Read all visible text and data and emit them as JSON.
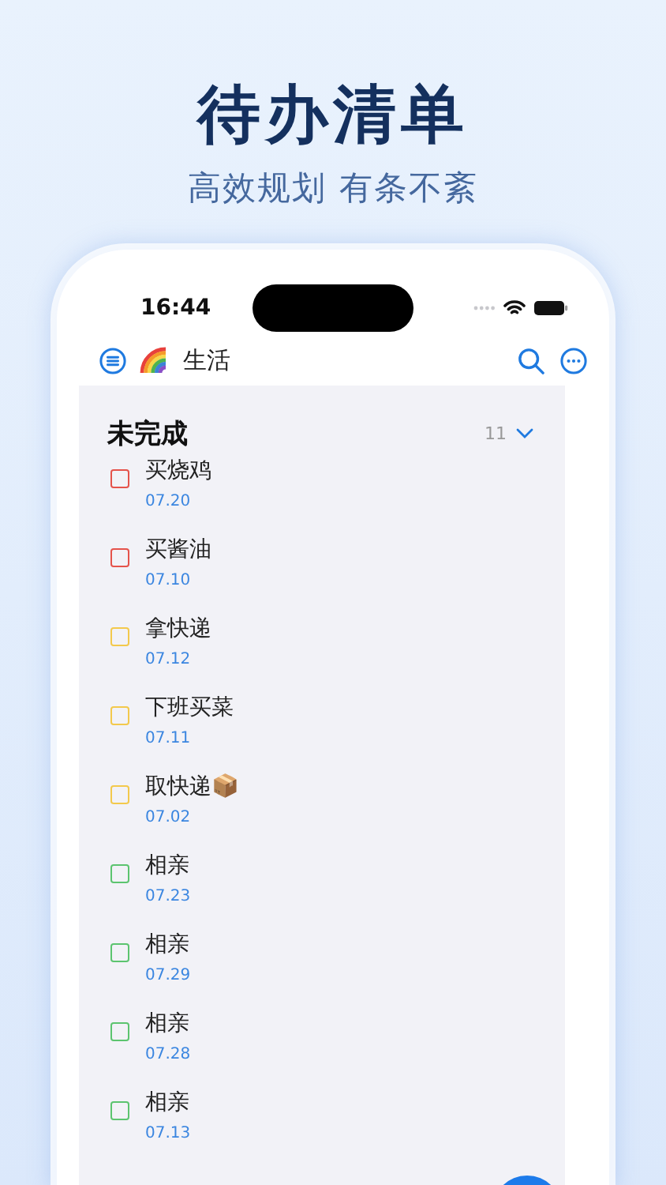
{
  "headline": {
    "title": "待办清单",
    "subtitle": "高效规划 有条不紊"
  },
  "status_bar": {
    "time": "16:44"
  },
  "header": {
    "list_name": "生活"
  },
  "section": {
    "title": "未完成",
    "count": "11",
    "expanded": true
  },
  "tasks": [
    {
      "title": "买烧鸡",
      "date": "07.20",
      "color": "#e5534b",
      "checked": false
    },
    {
      "title": "买酱油",
      "date": "07.10",
      "color": "#e5534b",
      "checked": false
    },
    {
      "title": "拿快递",
      "date": "07.12",
      "color": "#f3c94c",
      "checked": false
    },
    {
      "title": "下班买菜",
      "date": "07.11",
      "color": "#f3c94c",
      "checked": false
    },
    {
      "title": "取快递📦",
      "date": "07.02",
      "color": "#f3c94c",
      "checked": false
    },
    {
      "title": "相亲",
      "date": "07.23",
      "color": "#5cc46f",
      "checked": false
    },
    {
      "title": "相亲",
      "date": "07.29",
      "color": "#5cc46f",
      "checked": false
    },
    {
      "title": "相亲",
      "date": "07.28",
      "color": "#5cc46f",
      "checked": false
    },
    {
      "title": "相亲",
      "date": "07.13",
      "color": "#5cc46f",
      "checked": false
    }
  ]
}
